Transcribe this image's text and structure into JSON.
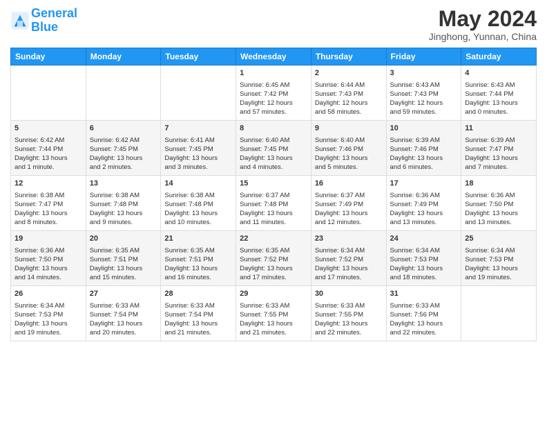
{
  "header": {
    "logo_line1": "General",
    "logo_line2": "Blue",
    "month": "May 2024",
    "location": "Jinghong, Yunnan, China"
  },
  "days_of_week": [
    "Sunday",
    "Monday",
    "Tuesday",
    "Wednesday",
    "Thursday",
    "Friday",
    "Saturday"
  ],
  "weeks": [
    {
      "cells": [
        {
          "day": "",
          "info": ""
        },
        {
          "day": "",
          "info": ""
        },
        {
          "day": "",
          "info": ""
        },
        {
          "day": "1",
          "info": "Sunrise: 6:45 AM\nSunset: 7:42 PM\nDaylight: 12 hours\nand 57 minutes."
        },
        {
          "day": "2",
          "info": "Sunrise: 6:44 AM\nSunset: 7:43 PM\nDaylight: 12 hours\nand 58 minutes."
        },
        {
          "day": "3",
          "info": "Sunrise: 6:43 AM\nSunset: 7:43 PM\nDaylight: 12 hours\nand 59 minutes."
        },
        {
          "day": "4",
          "info": "Sunrise: 6:43 AM\nSunset: 7:44 PM\nDaylight: 13 hours\nand 0 minutes."
        }
      ]
    },
    {
      "cells": [
        {
          "day": "5",
          "info": "Sunrise: 6:42 AM\nSunset: 7:44 PM\nDaylight: 13 hours\nand 1 minute."
        },
        {
          "day": "6",
          "info": "Sunrise: 6:42 AM\nSunset: 7:45 PM\nDaylight: 13 hours\nand 2 minutes."
        },
        {
          "day": "7",
          "info": "Sunrise: 6:41 AM\nSunset: 7:45 PM\nDaylight: 13 hours\nand 3 minutes."
        },
        {
          "day": "8",
          "info": "Sunrise: 6:40 AM\nSunset: 7:45 PM\nDaylight: 13 hours\nand 4 minutes."
        },
        {
          "day": "9",
          "info": "Sunrise: 6:40 AM\nSunset: 7:46 PM\nDaylight: 13 hours\nand 5 minutes."
        },
        {
          "day": "10",
          "info": "Sunrise: 6:39 AM\nSunset: 7:46 PM\nDaylight: 13 hours\nand 6 minutes."
        },
        {
          "day": "11",
          "info": "Sunrise: 6:39 AM\nSunset: 7:47 PM\nDaylight: 13 hours\nand 7 minutes."
        }
      ]
    },
    {
      "cells": [
        {
          "day": "12",
          "info": "Sunrise: 6:38 AM\nSunset: 7:47 PM\nDaylight: 13 hours\nand 8 minutes."
        },
        {
          "day": "13",
          "info": "Sunrise: 6:38 AM\nSunset: 7:48 PM\nDaylight: 13 hours\nand 9 minutes."
        },
        {
          "day": "14",
          "info": "Sunrise: 6:38 AM\nSunset: 7:48 PM\nDaylight: 13 hours\nand 10 minutes."
        },
        {
          "day": "15",
          "info": "Sunrise: 6:37 AM\nSunset: 7:48 PM\nDaylight: 13 hours\nand 11 minutes."
        },
        {
          "day": "16",
          "info": "Sunrise: 6:37 AM\nSunset: 7:49 PM\nDaylight: 13 hours\nand 12 minutes."
        },
        {
          "day": "17",
          "info": "Sunrise: 6:36 AM\nSunset: 7:49 PM\nDaylight: 13 hours\nand 13 minutes."
        },
        {
          "day": "18",
          "info": "Sunrise: 6:36 AM\nSunset: 7:50 PM\nDaylight: 13 hours\nand 13 minutes."
        }
      ]
    },
    {
      "cells": [
        {
          "day": "19",
          "info": "Sunrise: 6:36 AM\nSunset: 7:50 PM\nDaylight: 13 hours\nand 14 minutes."
        },
        {
          "day": "20",
          "info": "Sunrise: 6:35 AM\nSunset: 7:51 PM\nDaylight: 13 hours\nand 15 minutes."
        },
        {
          "day": "21",
          "info": "Sunrise: 6:35 AM\nSunset: 7:51 PM\nDaylight: 13 hours\nand 16 minutes."
        },
        {
          "day": "22",
          "info": "Sunrise: 6:35 AM\nSunset: 7:52 PM\nDaylight: 13 hours\nand 17 minutes."
        },
        {
          "day": "23",
          "info": "Sunrise: 6:34 AM\nSunset: 7:52 PM\nDaylight: 13 hours\nand 17 minutes."
        },
        {
          "day": "24",
          "info": "Sunrise: 6:34 AM\nSunset: 7:53 PM\nDaylight: 13 hours\nand 18 minutes."
        },
        {
          "day": "25",
          "info": "Sunrise: 6:34 AM\nSunset: 7:53 PM\nDaylight: 13 hours\nand 19 minutes."
        }
      ]
    },
    {
      "cells": [
        {
          "day": "26",
          "info": "Sunrise: 6:34 AM\nSunset: 7:53 PM\nDaylight: 13 hours\nand 19 minutes."
        },
        {
          "day": "27",
          "info": "Sunrise: 6:33 AM\nSunset: 7:54 PM\nDaylight: 13 hours\nand 20 minutes."
        },
        {
          "day": "28",
          "info": "Sunrise: 6:33 AM\nSunset: 7:54 PM\nDaylight: 13 hours\nand 21 minutes."
        },
        {
          "day": "29",
          "info": "Sunrise: 6:33 AM\nSunset: 7:55 PM\nDaylight: 13 hours\nand 21 minutes."
        },
        {
          "day": "30",
          "info": "Sunrise: 6:33 AM\nSunset: 7:55 PM\nDaylight: 13 hours\nand 22 minutes."
        },
        {
          "day": "31",
          "info": "Sunrise: 6:33 AM\nSunset: 7:56 PM\nDaylight: 13 hours\nand 22 minutes."
        },
        {
          "day": "",
          "info": ""
        }
      ]
    }
  ]
}
